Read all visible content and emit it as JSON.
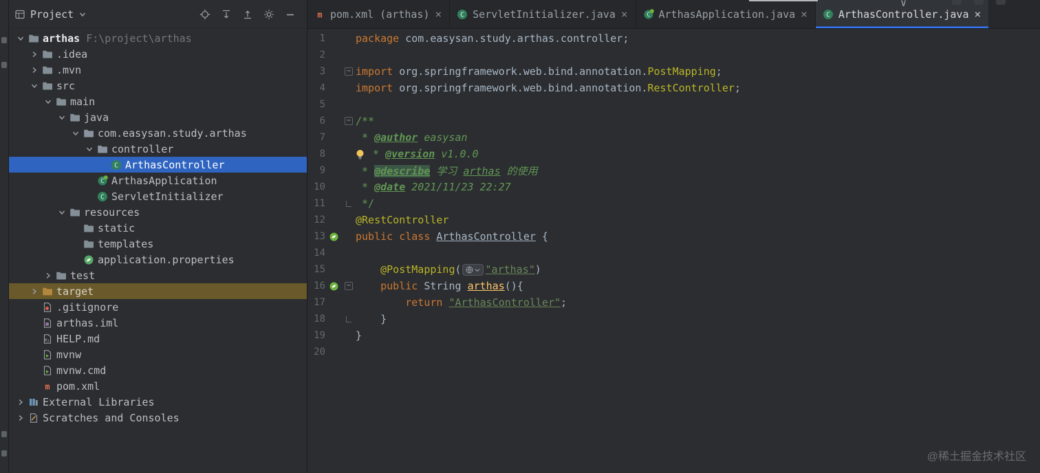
{
  "colors": {
    "accent_blue": "#3574f0",
    "selection_blue": "#2f64c1",
    "target_row_highlight": "#6a592b",
    "keyword": "#cc7832",
    "string": "#6a8759",
    "annotation": "#bbb529",
    "comment": "#629755",
    "method": "#ffc66d",
    "plain_text": "#a9b7c6"
  },
  "project_panel": {
    "header": {
      "title": "Project",
      "actions": [
        {
          "name": "locate-file-icon"
        },
        {
          "name": "expand-all-icon"
        },
        {
          "name": "collapse-all-icon"
        },
        {
          "name": "settings-gear-icon"
        },
        {
          "name": "hide-panel-icon"
        }
      ]
    },
    "tree": [
      {
        "label": "arthas",
        "suffix": "F:\\project\\arthas",
        "depth": 0,
        "chevron": "down",
        "icon": "folder",
        "bold": true
      },
      {
        "label": ".idea",
        "depth": 1,
        "chevron": "right",
        "icon": "folder"
      },
      {
        "label": ".mvn",
        "depth": 1,
        "chevron": "right",
        "icon": "folder"
      },
      {
        "label": "src",
        "depth": 1,
        "chevron": "down",
        "icon": "folder"
      },
      {
        "label": "main",
        "depth": 2,
        "chevron": "down",
        "icon": "folder"
      },
      {
        "label": "java",
        "depth": 3,
        "chevron": "down",
        "icon": "folder"
      },
      {
        "label": "com.easysan.study.arthas",
        "depth": 4,
        "chevron": "down",
        "icon": "package"
      },
      {
        "label": "controller",
        "depth": 5,
        "chevron": "down",
        "icon": "package"
      },
      {
        "label": "ArthasController",
        "depth": 6,
        "icon": "class",
        "state": "selected"
      },
      {
        "label": "ArthasApplication",
        "depth": 5,
        "icon": "boot-class"
      },
      {
        "label": "ServletInitializer",
        "depth": 5,
        "icon": "class"
      },
      {
        "label": "resources",
        "depth": 3,
        "chevron": "down",
        "icon": "folder"
      },
      {
        "label": "static",
        "depth": 4,
        "icon": "folder"
      },
      {
        "label": "templates",
        "depth": 4,
        "icon": "folder"
      },
      {
        "label": "application.properties",
        "depth": 4,
        "icon": "spring-properties"
      },
      {
        "label": "test",
        "depth": 2,
        "chevron": "right",
        "icon": "folder"
      },
      {
        "label": "target",
        "depth": 1,
        "chevron": "right",
        "icon": "folder-excluded",
        "state": "target"
      },
      {
        "label": ".gitignore",
        "depth": 1,
        "icon": "git-file"
      },
      {
        "label": "arthas.iml",
        "depth": 1,
        "icon": "iml-file"
      },
      {
        "label": "HELP.md",
        "depth": 1,
        "icon": "markdown-file"
      },
      {
        "label": "mvnw",
        "depth": 1,
        "icon": "script-file"
      },
      {
        "label": "mvnw.cmd",
        "depth": 1,
        "icon": "script-file"
      },
      {
        "label": "pom.xml",
        "depth": 1,
        "icon": "maven-file"
      },
      {
        "label": "External Libraries",
        "depth": 0,
        "chevron": "right",
        "icon": "library"
      },
      {
        "label": "Scratches and Consoles",
        "depth": 0,
        "chevron": "right",
        "icon": "scratch"
      }
    ]
  },
  "editor": {
    "tabs": [
      {
        "label": "pom.xml (arthas)",
        "icon": "maven-file",
        "active": false
      },
      {
        "label": "ServletInitializer.java",
        "icon": "class",
        "active": false
      },
      {
        "label": "ArthasApplication.java",
        "icon": "boot-class",
        "active": false
      },
      {
        "label": "ArthasController.java",
        "icon": "class",
        "active": true
      }
    ],
    "close_glyph": "×",
    "lines": [
      {
        "num": 1,
        "segs": [
          [
            "kw",
            "package"
          ],
          [
            "pl",
            " com.easysan.study.arthas.controller;"
          ]
        ]
      },
      {
        "num": 2,
        "segs": []
      },
      {
        "num": 3,
        "fold": "open",
        "segs": [
          [
            "kw",
            "import"
          ],
          [
            "pl",
            " org.springframework.web.bind.annotation."
          ],
          [
            "ann",
            "PostMapping"
          ],
          [
            "pl",
            ";"
          ]
        ]
      },
      {
        "num": 4,
        "segs": [
          [
            "kw",
            "import"
          ],
          [
            "pl",
            " org.springframework.web.bind.annotation."
          ],
          [
            "ann",
            "RestController"
          ],
          [
            "pl",
            ";"
          ]
        ]
      },
      {
        "num": 5,
        "segs": []
      },
      {
        "num": 6,
        "fold": "open",
        "segs": [
          [
            "cmt",
            "/**"
          ]
        ]
      },
      {
        "num": 7,
        "segs": [
          [
            "cmt",
            " * "
          ],
          [
            "tag",
            "@author"
          ],
          [
            "cmti",
            " easysan"
          ]
        ]
      },
      {
        "num": 8,
        "bulb": true,
        "segs": [
          [
            "cmt",
            " * "
          ],
          [
            "tag",
            "@version"
          ],
          [
            "cmti",
            " v1.0.0"
          ]
        ]
      },
      {
        "num": 9,
        "segs": [
          [
            "cmt",
            " * "
          ],
          [
            "tag hl",
            "@describe"
          ],
          [
            "cmti",
            " 学习 "
          ],
          [
            "cmti u",
            "arthas"
          ],
          [
            "cmti",
            " 的使用"
          ]
        ]
      },
      {
        "num": 10,
        "segs": [
          [
            "cmt",
            " * "
          ],
          [
            "tag",
            "@date"
          ],
          [
            "cmti",
            " 2021/11/23 22:27"
          ]
        ]
      },
      {
        "num": 11,
        "fold": "close",
        "segs": [
          [
            "cmt",
            " */"
          ]
        ]
      },
      {
        "num": 12,
        "segs": [
          [
            "ann",
            "@RestController"
          ]
        ]
      },
      {
        "num": 13,
        "gutter": "spring-bean",
        "segs": [
          [
            "kw",
            "public"
          ],
          [
            "pl",
            " "
          ],
          [
            "kw",
            "class"
          ],
          [
            "pl",
            " "
          ],
          [
            "pl u",
            "ArthasController"
          ],
          [
            "pl",
            " {"
          ]
        ]
      },
      {
        "num": 14,
        "segs": []
      },
      {
        "num": 15,
        "segs": [
          [
            "pl",
            "    "
          ],
          [
            "ann",
            "@PostMapping"
          ],
          [
            "pl",
            "("
          ],
          [
            "inlay",
            ""
          ],
          [
            "str u",
            "\"arthas\""
          ],
          [
            "pl",
            ")"
          ]
        ]
      },
      {
        "num": 16,
        "gutter": "spring-bean",
        "fold": "open",
        "segs": [
          [
            "pl",
            "    "
          ],
          [
            "kw",
            "public"
          ],
          [
            "pl",
            " String "
          ],
          [
            "mth u",
            "arthas"
          ],
          [
            "pl",
            "(){"
          ]
        ]
      },
      {
        "num": 17,
        "segs": [
          [
            "pl",
            "        "
          ],
          [
            "kw",
            "return"
          ],
          [
            "pl",
            " "
          ],
          [
            "str u",
            "\"ArthasController\""
          ],
          [
            "pl",
            ";"
          ]
        ]
      },
      {
        "num": 18,
        "fold": "close",
        "segs": [
          [
            "pl",
            "    }"
          ]
        ]
      },
      {
        "num": 19,
        "segs": [
          [
            "pl",
            "}"
          ]
        ]
      },
      {
        "num": 20,
        "segs": []
      }
    ]
  },
  "watermark": "@稀土掘金技术社区"
}
